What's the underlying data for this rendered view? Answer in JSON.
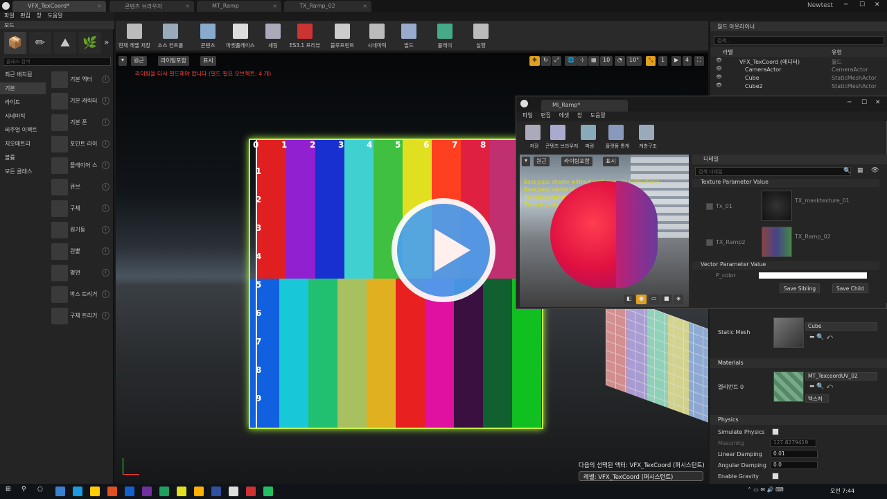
{
  "tabs": [
    {
      "label": "VFX_TexCoord*"
    },
    {
      "label": "콘텐츠 브라우저"
    },
    {
      "label": "MT_Ramp"
    },
    {
      "label": "TX_Ramp_02"
    }
  ],
  "window_title": "Newtest",
  "menu": [
    "파일",
    "편집",
    "창",
    "도움말"
  ],
  "modes": {
    "header": "모드",
    "search_placeholder": "클래스 검색",
    "categories": [
      "최근 배치됨",
      "기본",
      "라이트",
      "시네마틱",
      "비주얼 이펙트",
      "지오메트리",
      "볼륨",
      "모든 클래스"
    ],
    "selected_category": "기본",
    "actors": [
      "기본 액터",
      "기본 캐릭터",
      "기본 폰",
      "포인트 라이",
      "플레이어 스",
      "큐브",
      "구체",
      "원기둥",
      "원뿔",
      "평면",
      "박스 트리거",
      "구체 트리거"
    ]
  },
  "toolbar": [
    {
      "label": "현재 레벨 저장"
    },
    {
      "label": "소스 컨트롤"
    },
    {
      "label": "콘텐츠"
    },
    {
      "label": "마켓플레이스"
    },
    {
      "label": "세팅"
    },
    {
      "label": "ES3.1 프리뷰"
    },
    {
      "label": "블루프린트"
    },
    {
      "label": "시네마틱"
    },
    {
      "label": "빌드"
    },
    {
      "label": "플레이"
    },
    {
      "label": "실행"
    }
  ],
  "viewport": {
    "view_mode": "원근",
    "lighting": "라이팅포함",
    "show": "표시",
    "warning": "라이팅을 다시 빌드해야 합니다 (빌드 필요 오브젝트: 4 개)",
    "snap_angle": "10°",
    "grid_num": "10",
    "scale_num": "1",
    "cam_speed": "4",
    "ramp_numbers_top": [
      "0",
      "1",
      "2",
      "3",
      "4",
      "5",
      "6",
      "7",
      "8"
    ],
    "ramp_numbers_left": [
      "1",
      "2",
      "3",
      "4",
      "5",
      "6",
      "7",
      "8",
      "9"
    ],
    "selection_info": "다음의 선택된 액터:  VFX_TexCoord (퍼시스턴트)",
    "level_label": "레벨:  VFX_TexCoord (퍼시스턴트)"
  },
  "outliner": {
    "header": "월드 아웃라이너",
    "search_placeholder": "검색...",
    "col_label": "라벨",
    "col_type": "유형",
    "rows": [
      {
        "name": "VFX_TexCoord (에디터)",
        "type": "월드"
      },
      {
        "name": "CameraActor",
        "type": "CameraActor"
      },
      {
        "name": "Cube",
        "type": "StaticMeshActor"
      },
      {
        "name": "Cube2",
        "type": "StaticMeshActor"
      }
    ]
  },
  "material_editor": {
    "tab": "MI_Ramp*",
    "menu": [
      "파일",
      "편집",
      "에셋",
      "창",
      "도움말"
    ],
    "tools": [
      "저장",
      "콘텐츠 브라우저",
      "파랑",
      "플랫폼 통계",
      "계층구조"
    ],
    "preview_view": "원근",
    "preview_lighting": "라이팅포함",
    "preview_show": "표시",
    "stats": [
      "Base pass shader without light map: 34 instructions",
      "Base pass vertex shader: 45 instructions",
      "Texture samplers: 1/16",
      "Texture Lookups (Est.): VS(0), PS(1)"
    ],
    "details_header": "디테일",
    "details_search": "검색 디테일",
    "sect_texture": "Texture Parameter Value",
    "param1": "Tx_01",
    "param1_val": "TX_masktexture_01",
    "param2": "TX_Ramp2",
    "param2_val": "TX_Ramp_02",
    "sect_vector": "Vector Parameter Value",
    "param3": "P_color",
    "save_sibling": "Save Sibling",
    "save_child": "Save Child"
  },
  "details": {
    "static_mesh_label": "Static Mesh",
    "static_mesh_value": "Cube",
    "materials_header": "Materials",
    "element_label": "엘리먼트 0",
    "material_value": "MT_TexcoordUV_02",
    "texture_btn": "텍스처",
    "physics_header": "Physics",
    "simulate_physics": "Simulate Physics",
    "mass_kg": "MassInKg",
    "mass_value": "127.8279419",
    "linear_damping": "Linear Damping",
    "linear_value": "0.01",
    "angular_damping": "Angular Damping",
    "angular_value": "0.0",
    "enable_gravity": "Enable Gravity"
  },
  "taskbar": {
    "time": "오전 7:44"
  },
  "colors": {
    "accent": "#4aa0f0",
    "ramp_border": "#c6ff4a",
    "warning": "#ff4040"
  }
}
